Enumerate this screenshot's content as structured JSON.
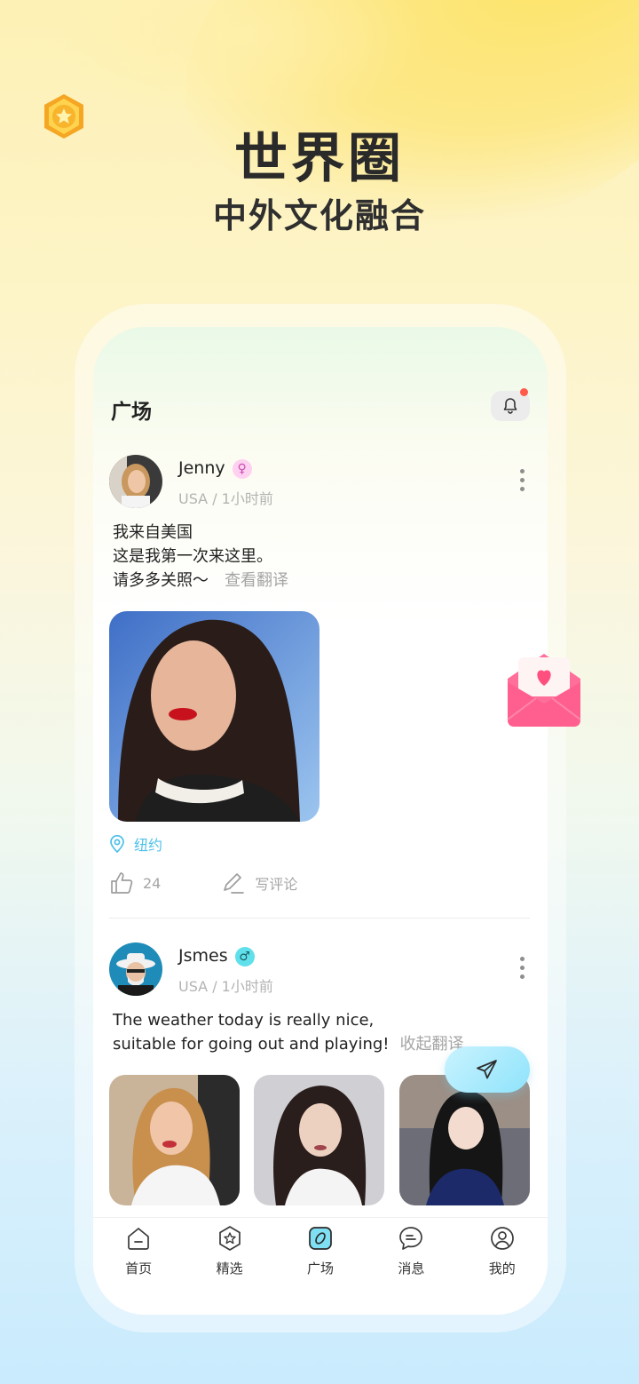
{
  "hero": {
    "title": "世界圈",
    "subtitle": "中外文化融合"
  },
  "screen": {
    "title": "广场"
  },
  "posts": [
    {
      "name": "Jenny",
      "gender_symbol": "♀",
      "meta": "USA / 1小时前",
      "lines": [
        "我来自美国",
        "这是我第一次来这里。",
        "请多多关照～"
      ],
      "translate_label": "查看翻译",
      "location": "纽约",
      "likes": "24",
      "comment_label": "写评论"
    },
    {
      "name": "Jsmes",
      "gender_symbol": "♂",
      "meta": "USA / 1小时前",
      "lines": [
        "The weather today is really nice,",
        "suitable for going out and playing!"
      ],
      "translate_label": "收起翻译"
    }
  ],
  "tabs": [
    {
      "label": "首页",
      "icon": "home-icon"
    },
    {
      "label": "精选",
      "icon": "star-icon"
    },
    {
      "label": "广场",
      "icon": "plaza-icon"
    },
    {
      "label": "消息",
      "icon": "message-icon"
    },
    {
      "label": "我的",
      "icon": "profile-icon"
    }
  ],
  "colors": {
    "accent": "#4cc0e8",
    "female": "#ffb3e9",
    "male": "#5fe0ea",
    "notify": "#ff5b4a"
  }
}
